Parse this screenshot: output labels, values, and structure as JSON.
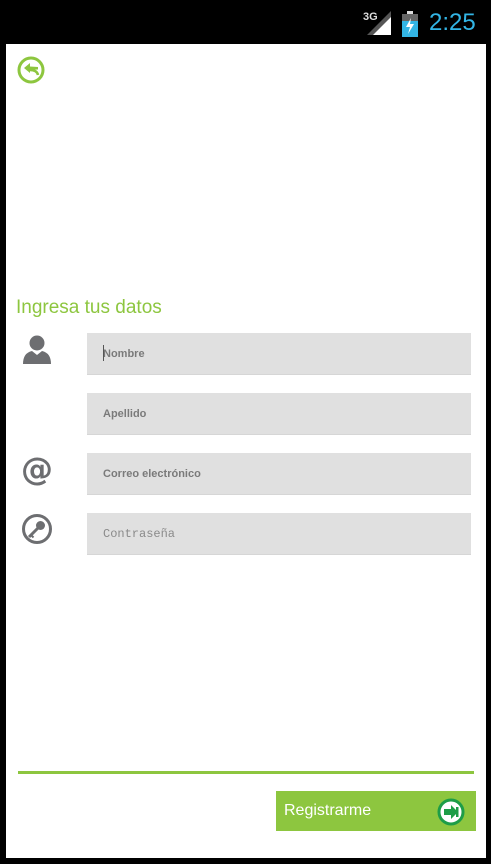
{
  "status_bar": {
    "network": "3G",
    "time": "2:25"
  },
  "form": {
    "title": "Ingresa tus datos",
    "fields": {
      "nombre": "Nombre",
      "apellido": "Apellido",
      "correo": "Correo electrónico",
      "contrasena": "Contraseña"
    }
  },
  "footer": {
    "register_label": "Registrarme"
  },
  "colors": {
    "accent": "#8dc63f",
    "clock": "#33b5e5",
    "icon_gray": "#6d6e71",
    "field_bg": "#e0e0e0"
  },
  "icons": {
    "back": "back-arrow-circle-icon",
    "user": "person-icon",
    "email": "at-sign-icon",
    "password": "key-icon",
    "register": "forward-circle-icon"
  }
}
